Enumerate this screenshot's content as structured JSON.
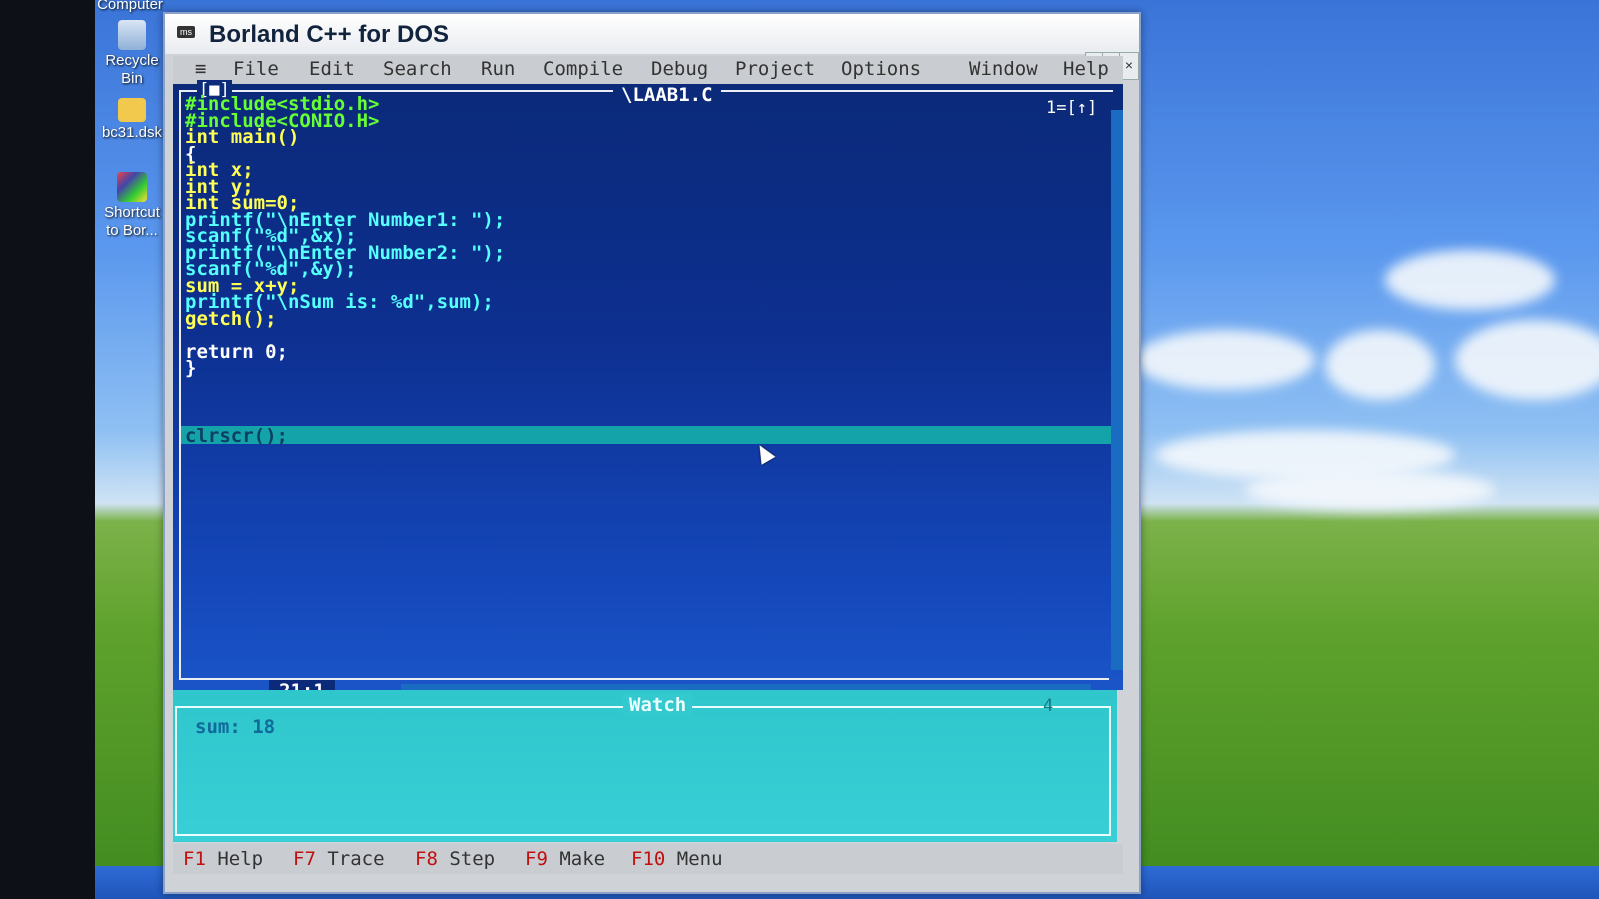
{
  "desktop": {
    "icons": [
      {
        "label": "Computer"
      },
      {
        "label": "Recycle Bin"
      },
      {
        "label": "bc31.dsk"
      },
      {
        "label": "Shortcut to Bor..."
      }
    ]
  },
  "window": {
    "title": "Borland C++ for DOS",
    "controls": {
      "minimize": "-",
      "maximize": "□",
      "close": "×"
    }
  },
  "menubar": {
    "system": "≡",
    "items": [
      "File",
      "Edit",
      "Search",
      "Run",
      "Compile",
      "Debug",
      "Project",
      "Options",
      "Window",
      "Help"
    ]
  },
  "editor": {
    "close_box": "[■]",
    "filename": "\\LAAB1.C",
    "window_number": "1=[↑]",
    "cursor_position": "21:1",
    "code_lines": [
      "#include<stdio.h>",
      "#include<CONIO.H>",
      "",
      "int main()",
      "{",
      "int x;",
      "int y;",
      "int sum=0;",
      "",
      "printf(\"\\nEnter Number1: \");",
      "scanf(\"%d\",&x);",
      "",
      "printf(\"\\nEnter Number2: \");",
      "scanf(\"%d\",&y);",
      "",
      "",
      "sum = x+y;",
      "printf(\"\\nSum is: %d\",sum);",
      "getch();",
      "",
      "clrscr();",
      "",
      "return 0;",
      "}"
    ],
    "execution_line": "clrscr();"
  },
  "watch": {
    "title": "Watch",
    "window_number": "4",
    "entries": [
      "sum: 18"
    ]
  },
  "statusbar": {
    "items": [
      {
        "key": "F1",
        "label": "Help"
      },
      {
        "key": "F7",
        "label": "Trace"
      },
      {
        "key": "F8",
        "label": "Step"
      },
      {
        "key": "F9",
        "label": "Make"
      },
      {
        "key": "F10",
        "label": "Menu"
      }
    ]
  }
}
